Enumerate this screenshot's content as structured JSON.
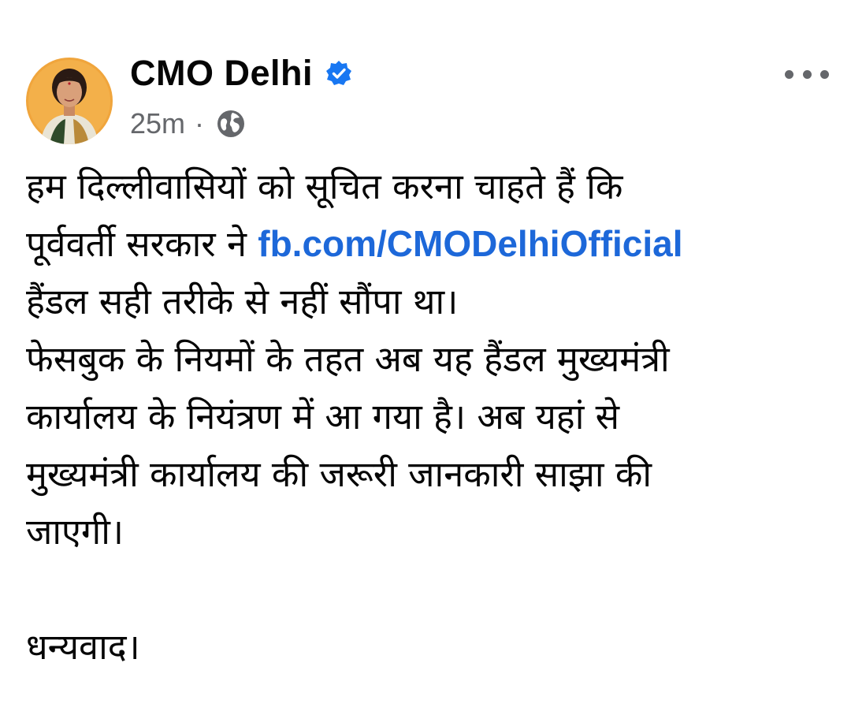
{
  "post": {
    "author": "CMO Delhi",
    "verified_icon": "verified-badge-icon",
    "timestamp": "25m",
    "separator": "·",
    "audience_icon": "globe-icon",
    "more_icon": "more-options-icon",
    "body": {
      "line1": "हम दिल्लीवासियों को सूचित करना चाहते हैं कि",
      "line2_before_link": "पूर्ववर्ती सरकार ने ",
      "link_text": "fb.com/CMODelhiOfficial",
      "line3": "हैंडल सही तरीके से नहीं सौंपा था।",
      "line4": "फेसबुक के नियमों के तहत अब यह हैंडल मुख्यमंत्री",
      "line5": "कार्यालय के नियंत्रण में आ गया है। अब यहां से",
      "line6": "मुख्यमंत्री कार्यालय की जरूरी जानकारी साझा की",
      "line7": "जाएगी।",
      "line9": "धन्यवाद।"
    },
    "colors": {
      "link": "#1d68d9",
      "verified": "#1877f2",
      "meta": "#65676b",
      "avatar_bg": "#f0a53c"
    }
  }
}
